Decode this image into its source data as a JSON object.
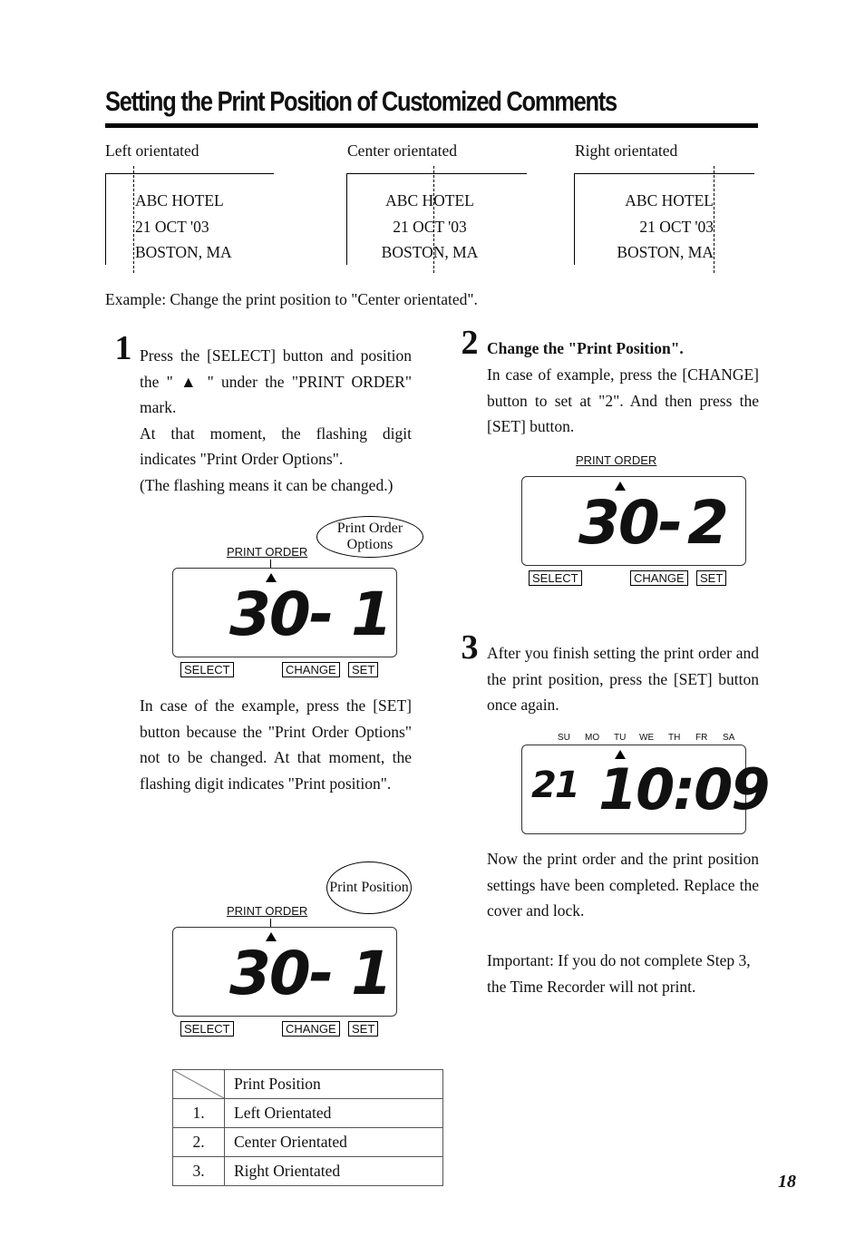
{
  "title": "Setting the Print Position of Customized Comments",
  "orientations": [
    {
      "label": "Left orientated",
      "lines": [
        "ABC  HOTEL",
        "21  OCT  '03",
        "BOSTON,  MA"
      ]
    },
    {
      "label": "Center orientated",
      "lines": [
        "ABC  HOTEL",
        "21  OCT  '03",
        "BOSTON,  MA"
      ]
    },
    {
      "label": "Right orientated",
      "lines": [
        "ABC  HOTEL",
        "21  OCT  '03",
        "BOSTON,  MA"
      ]
    }
  ],
  "example": "Example: Change the print position to \"Center orientated\".",
  "step1": {
    "number": "1",
    "p1": "Press the [SELECT] button and position the \" ▲ \" under the \"PRINT ORDER\" mark.",
    "p2": "At that moment, the flashing digit indicates \"Print Order Options\".",
    "p3": " (The flashing means it can be changed.)",
    "p4": "In case of the example, press the [SET] button because the \"Print Order Options\" not to be changed. At that moment, the flashing digit indicates \"Print position\"."
  },
  "step2": {
    "number": "2",
    "heading": "Change the \"Print Position\".",
    "text": "In case of example, press the [CHANGE] button to set at \"2\". And then press the [SET] button."
  },
  "step3": {
    "number": "3",
    "text": "After you finish setting the print order and the print position, press the [SET] button once again.",
    "done": "Now the print order and the print position settings have been completed. Replace the cover and lock.",
    "important": "Important: If you do not complete Step 3, the Time Recorder will  not print."
  },
  "display": {
    "print_order_label": "PRINT ORDER",
    "select": "SELECT",
    "change": "CHANGE",
    "set": "SET"
  },
  "lcd1": {
    "left": "30-",
    "right": "1",
    "callout": "Print Order Options"
  },
  "lcd2": {
    "left": "30-",
    "right": "1",
    "callout": "Print Position"
  },
  "lcd3": {
    "left": "30-",
    "right": "2"
  },
  "lcd4": {
    "day": "21",
    "time": "10:09",
    "days": [
      "SU",
      "MO",
      "TU",
      "WE",
      "TH",
      "FR",
      "SA"
    ]
  },
  "table": {
    "header": "Print Position",
    "rows": [
      [
        "1.",
        "Left Orientated"
      ],
      [
        "2.",
        "Center Orientated"
      ],
      [
        "3.",
        "Right Orientated"
      ]
    ]
  },
  "page_number": "18"
}
